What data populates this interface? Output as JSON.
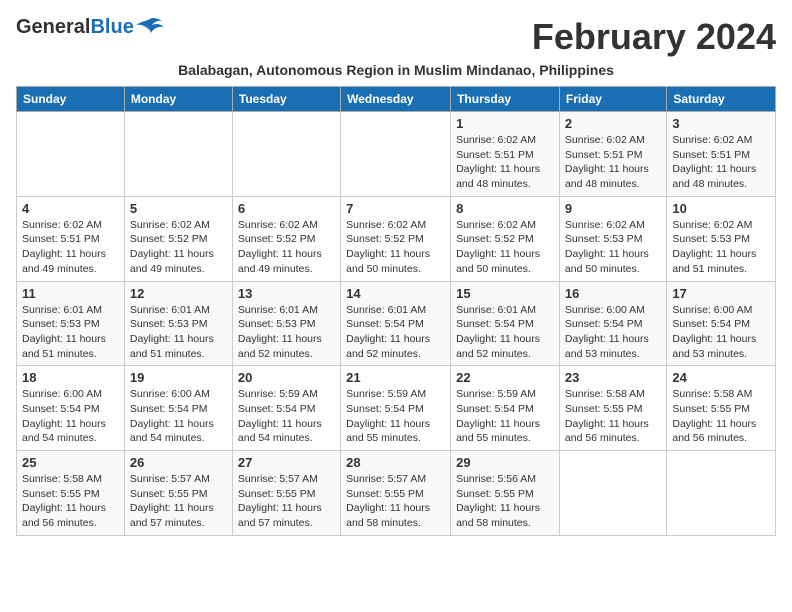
{
  "logo": {
    "general": "General",
    "blue": "Blue"
  },
  "title": "February 2024",
  "subtitle": "Balabagan, Autonomous Region in Muslim Mindanao, Philippines",
  "days_of_week": [
    "Sunday",
    "Monday",
    "Tuesday",
    "Wednesday",
    "Thursday",
    "Friday",
    "Saturday"
  ],
  "weeks": [
    [
      {
        "day": "",
        "info": ""
      },
      {
        "day": "",
        "info": ""
      },
      {
        "day": "",
        "info": ""
      },
      {
        "day": "",
        "info": ""
      },
      {
        "day": "1",
        "info": "Sunrise: 6:02 AM\nSunset: 5:51 PM\nDaylight: 11 hours and 48 minutes."
      },
      {
        "day": "2",
        "info": "Sunrise: 6:02 AM\nSunset: 5:51 PM\nDaylight: 11 hours and 48 minutes."
      },
      {
        "day": "3",
        "info": "Sunrise: 6:02 AM\nSunset: 5:51 PM\nDaylight: 11 hours and 48 minutes."
      }
    ],
    [
      {
        "day": "4",
        "info": "Sunrise: 6:02 AM\nSunset: 5:51 PM\nDaylight: 11 hours and 49 minutes."
      },
      {
        "day": "5",
        "info": "Sunrise: 6:02 AM\nSunset: 5:52 PM\nDaylight: 11 hours and 49 minutes."
      },
      {
        "day": "6",
        "info": "Sunrise: 6:02 AM\nSunset: 5:52 PM\nDaylight: 11 hours and 49 minutes."
      },
      {
        "day": "7",
        "info": "Sunrise: 6:02 AM\nSunset: 5:52 PM\nDaylight: 11 hours and 50 minutes."
      },
      {
        "day": "8",
        "info": "Sunrise: 6:02 AM\nSunset: 5:52 PM\nDaylight: 11 hours and 50 minutes."
      },
      {
        "day": "9",
        "info": "Sunrise: 6:02 AM\nSunset: 5:53 PM\nDaylight: 11 hours and 50 minutes."
      },
      {
        "day": "10",
        "info": "Sunrise: 6:02 AM\nSunset: 5:53 PM\nDaylight: 11 hours and 51 minutes."
      }
    ],
    [
      {
        "day": "11",
        "info": "Sunrise: 6:01 AM\nSunset: 5:53 PM\nDaylight: 11 hours and 51 minutes."
      },
      {
        "day": "12",
        "info": "Sunrise: 6:01 AM\nSunset: 5:53 PM\nDaylight: 11 hours and 51 minutes."
      },
      {
        "day": "13",
        "info": "Sunrise: 6:01 AM\nSunset: 5:53 PM\nDaylight: 11 hours and 52 minutes."
      },
      {
        "day": "14",
        "info": "Sunrise: 6:01 AM\nSunset: 5:54 PM\nDaylight: 11 hours and 52 minutes."
      },
      {
        "day": "15",
        "info": "Sunrise: 6:01 AM\nSunset: 5:54 PM\nDaylight: 11 hours and 52 minutes."
      },
      {
        "day": "16",
        "info": "Sunrise: 6:00 AM\nSunset: 5:54 PM\nDaylight: 11 hours and 53 minutes."
      },
      {
        "day": "17",
        "info": "Sunrise: 6:00 AM\nSunset: 5:54 PM\nDaylight: 11 hours and 53 minutes."
      }
    ],
    [
      {
        "day": "18",
        "info": "Sunrise: 6:00 AM\nSunset: 5:54 PM\nDaylight: 11 hours and 54 minutes."
      },
      {
        "day": "19",
        "info": "Sunrise: 6:00 AM\nSunset: 5:54 PM\nDaylight: 11 hours and 54 minutes."
      },
      {
        "day": "20",
        "info": "Sunrise: 5:59 AM\nSunset: 5:54 PM\nDaylight: 11 hours and 54 minutes."
      },
      {
        "day": "21",
        "info": "Sunrise: 5:59 AM\nSunset: 5:54 PM\nDaylight: 11 hours and 55 minutes."
      },
      {
        "day": "22",
        "info": "Sunrise: 5:59 AM\nSunset: 5:54 PM\nDaylight: 11 hours and 55 minutes."
      },
      {
        "day": "23",
        "info": "Sunrise: 5:58 AM\nSunset: 5:55 PM\nDaylight: 11 hours and 56 minutes."
      },
      {
        "day": "24",
        "info": "Sunrise: 5:58 AM\nSunset: 5:55 PM\nDaylight: 11 hours and 56 minutes."
      }
    ],
    [
      {
        "day": "25",
        "info": "Sunrise: 5:58 AM\nSunset: 5:55 PM\nDaylight: 11 hours and 56 minutes."
      },
      {
        "day": "26",
        "info": "Sunrise: 5:57 AM\nSunset: 5:55 PM\nDaylight: 11 hours and 57 minutes."
      },
      {
        "day": "27",
        "info": "Sunrise: 5:57 AM\nSunset: 5:55 PM\nDaylight: 11 hours and 57 minutes."
      },
      {
        "day": "28",
        "info": "Sunrise: 5:57 AM\nSunset: 5:55 PM\nDaylight: 11 hours and 58 minutes."
      },
      {
        "day": "29",
        "info": "Sunrise: 5:56 AM\nSunset: 5:55 PM\nDaylight: 11 hours and 58 minutes."
      },
      {
        "day": "",
        "info": ""
      },
      {
        "day": "",
        "info": ""
      }
    ]
  ]
}
